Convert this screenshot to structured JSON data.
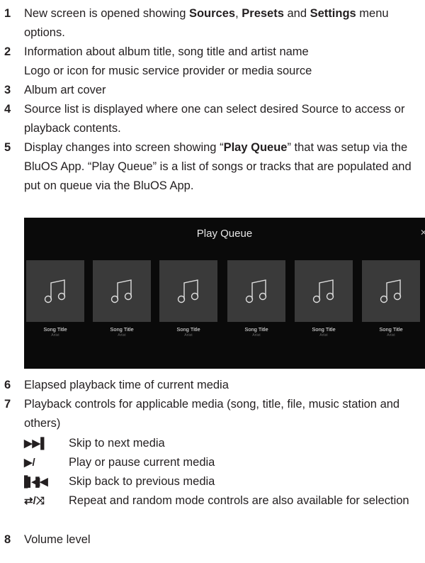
{
  "items": [
    {
      "num": "1",
      "parts": [
        {
          "t": "New screen is opened showing "
        },
        {
          "t": "Sources",
          "b": true
        },
        {
          "t": ", "
        },
        {
          "t": "Presets",
          "b": true
        },
        {
          "t": " and "
        },
        {
          "t": "Settings",
          "b": true
        },
        {
          "t": " menu options."
        }
      ]
    },
    {
      "num": "2",
      "lines": [
        "Information about album title, song title and artist name",
        "Logo or icon for music service provider or media source"
      ]
    },
    {
      "num": "3",
      "lines": [
        "Album art cover"
      ]
    },
    {
      "num": "4",
      "lines": [
        "Source list is displayed where one can select desired Source to access or playback contents."
      ]
    },
    {
      "num": "5",
      "parts": [
        {
          "t": "Display changes into screen showing “"
        },
        {
          "t": "Play Queue",
          "b": true
        },
        {
          "t": "” that was setup via the BluOS App.  “Play Queue” is a list of songs or tracks that are populated and put on queue via the BluOS App."
        }
      ]
    },
    {
      "num": "6",
      "lines": [
        "Elapsed playback time of current media"
      ]
    },
    {
      "num": "7",
      "lines": [
        "Playback controls for applicable media (song, title, file, music station and others)"
      ]
    },
    {
      "num": "8",
      "lines": [
        "Volume level"
      ]
    }
  ],
  "queue": {
    "title": "Play Queue",
    "close_glyph": "✕",
    "tiles": [
      {
        "song": "Song Title",
        "artist": "Artist"
      },
      {
        "song": "Song Title",
        "artist": "Artist"
      },
      {
        "song": "Song Title",
        "artist": "Artist"
      },
      {
        "song": "Song Title",
        "artist": "Artist"
      },
      {
        "song": "Song Title",
        "artist": "Artist"
      },
      {
        "song": "Song Title",
        "artist": "Artist"
      }
    ]
  },
  "controls": [
    {
      "symbol": "▶▶▌",
      "icon": "skip-next-icon",
      "text": "Skip to next media"
    },
    {
      "symbol": "▶/❚❚",
      "icon": "play-pause-icon",
      "text": "Play or pause current media"
    },
    {
      "symbol": "▌◀◀",
      "icon": "skip-back-icon",
      "text": "Skip back to previous media"
    },
    {
      "symbol": "⇄/⤨",
      "icon": "repeat-shuffle-icon",
      "text": "Repeat and random mode controls are also available for selection"
    }
  ]
}
